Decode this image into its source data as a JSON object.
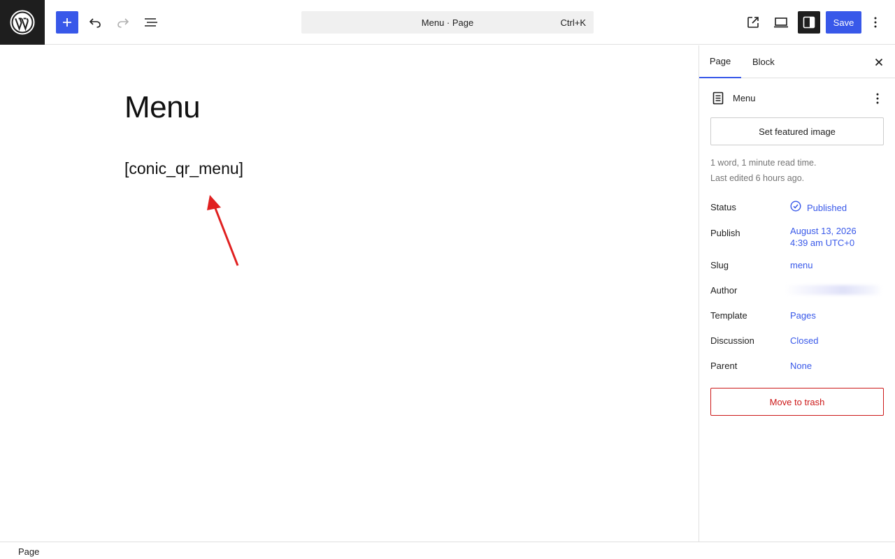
{
  "topbar": {
    "command_center": {
      "title": "Menu · Page",
      "shortcut": "Ctrl+K"
    },
    "save_label": "Save",
    "accent_color": "#3858e9"
  },
  "canvas": {
    "title": "Menu",
    "shortcode": "[conic_qr_menu]",
    "annotation_arrow_color": "#e02020"
  },
  "sidebar": {
    "tabs": [
      {
        "label": "Page"
      },
      {
        "label": "Block"
      }
    ],
    "document": {
      "title": "Menu"
    },
    "featured_image_label": "Set featured image",
    "meta": {
      "word_count": "1 word, 1 minute read time.",
      "last_edited": "Last edited 6 hours ago."
    },
    "properties": {
      "status": {
        "label": "Status",
        "value": "Published"
      },
      "publish": {
        "label": "Publish",
        "date": "August 13, 2026",
        "time": "4:39 am UTC+0"
      },
      "slug": {
        "label": "Slug",
        "value": "menu"
      },
      "author": {
        "label": "Author"
      },
      "template": {
        "label": "Template",
        "value": "Pages"
      },
      "discussion": {
        "label": "Discussion",
        "value": "Closed"
      },
      "parent": {
        "label": "Parent",
        "value": "None"
      }
    },
    "trash_label": "Move to trash"
  },
  "footer": {
    "breadcrumb": "Page"
  }
}
